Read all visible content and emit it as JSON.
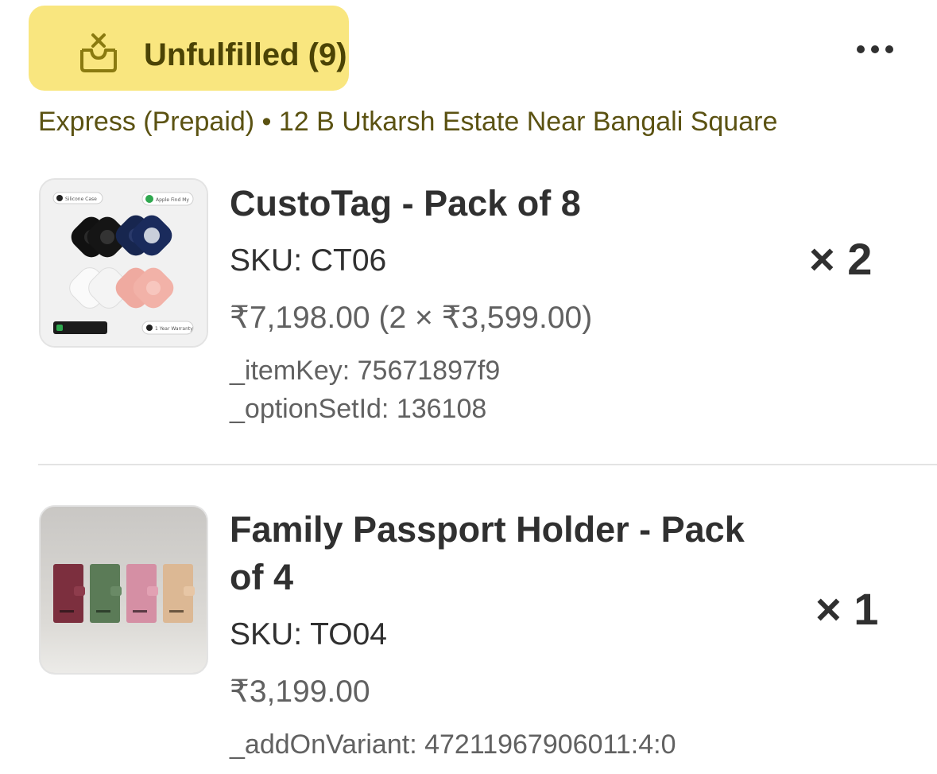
{
  "fulfillment": {
    "status_label": "Unfulfilled (9)",
    "status_color": "#f9e67f",
    "status_icon": "unfulfilled-box-icon",
    "more_icon": "more-horizontal-icon",
    "delivery_info": "Express (Prepaid) • 12 B Utkarsh Estate Near Bangali Square"
  },
  "items": [
    {
      "title": "CustoTag - Pack of 8",
      "sku": "SKU: CT06",
      "price": "₹7,198.00 (2 × ₹3,599.00)",
      "quantity": "× 2",
      "properties": [
        "_itemKey: 75671897f9",
        "_optionSetId: 136108"
      ],
      "image_labels": {
        "top_left": "Silicone Case",
        "top_right": "Apple Find My",
        "bottom_right": "1 Year Warranty"
      }
    },
    {
      "title": "Family Passport Holder - Pack of 4",
      "sku": "SKU: TO04",
      "price": "₹3,199.00",
      "quantity": "× 1",
      "properties": [
        "_addOnVariant: 47211967906011:4:0"
      ]
    }
  ]
}
